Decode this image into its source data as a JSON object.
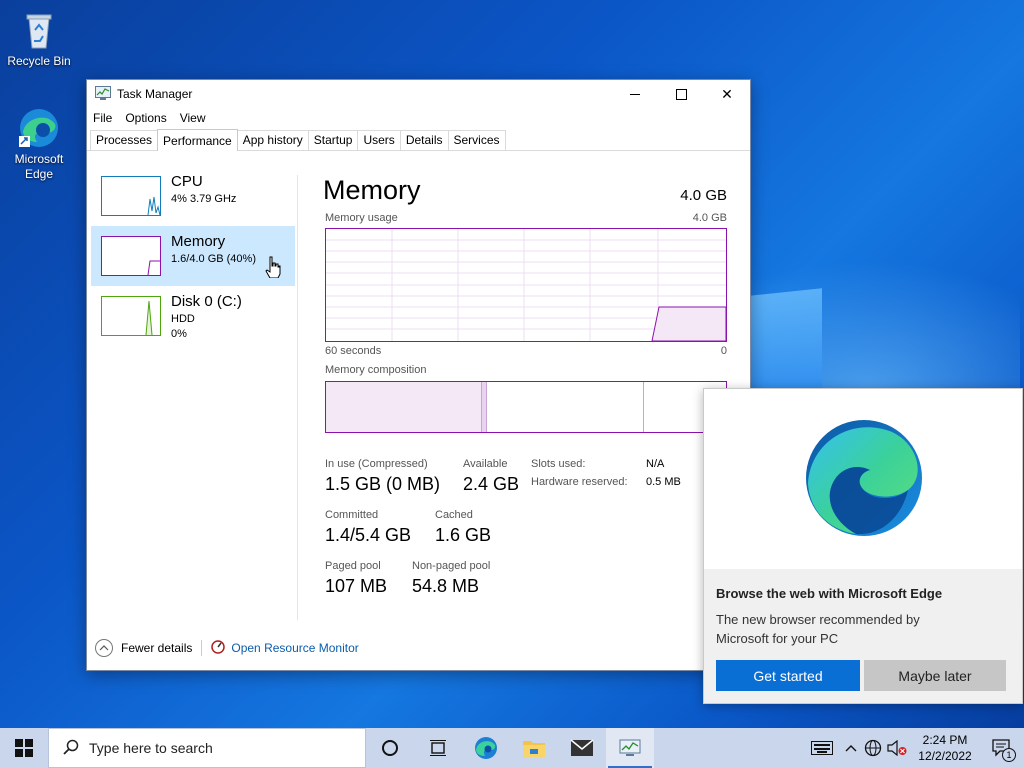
{
  "desktop": {
    "icons": [
      {
        "label": "Recycle Bin"
      },
      {
        "label": "Microsoft Edge"
      }
    ]
  },
  "window": {
    "title": "Task Manager",
    "controls": {
      "minimize": "—",
      "maximize": "☐",
      "close": "✕"
    },
    "menu": [
      "File",
      "Options",
      "View"
    ],
    "tabs": [
      "Processes",
      "Performance",
      "App history",
      "Startup",
      "Users",
      "Details",
      "Services"
    ],
    "active_tab": "Performance",
    "resources": [
      {
        "name": "CPU",
        "line1": "4% 3.79 GHz",
        "line2": "",
        "color": "#117dbb"
      },
      {
        "name": "Memory",
        "line1": "1.6/4.0 GB (40%)",
        "line2": "",
        "color": "#8b12ae"
      },
      {
        "name": "Disk 0 (C:)",
        "line1": "HDD",
        "line2": "0%",
        "color": "#4da60c"
      }
    ],
    "memory": {
      "title": "Memory",
      "total": "4.0 GB",
      "usage_label": "Memory usage",
      "usage_max": "4.0 GB",
      "axis_left": "60 seconds",
      "axis_right": "0",
      "composition_label": "Memory composition",
      "in_use_label": "In use (Compressed)",
      "in_use_value": "1.5 GB (0 MB)",
      "available_label": "Available",
      "available_value": "2.4 GB",
      "committed_label": "Committed",
      "committed_value": "1.4/5.4 GB",
      "cached_label": "Cached",
      "cached_value": "1.6 GB",
      "paged_label": "Paged pool",
      "paged_value": "107 MB",
      "nonpaged_label": "Non-paged pool",
      "nonpaged_value": "54.8 MB",
      "slots_label": "Slots used:",
      "slots_value": "N/A",
      "hw_label": "Hardware reserved:",
      "hw_value": "0.5 MB",
      "usage_fraction": 0.4,
      "accent": "#8b12ae"
    },
    "footer": {
      "fewer_details": "Fewer details",
      "open_resource_monitor": "Open Resource Monitor"
    }
  },
  "edge_popup": {
    "title": "Browse the web with Microsoft Edge",
    "description": "The new browser recommended by Microsoft for your PC",
    "primary_button": "Get started",
    "secondary_button": "Maybe later",
    "primary_color": "#0a6fd4"
  },
  "taskbar": {
    "search_placeholder": "Type here to search",
    "time": "2:24 PM",
    "date": "12/2/2022",
    "notification_count": "1"
  }
}
